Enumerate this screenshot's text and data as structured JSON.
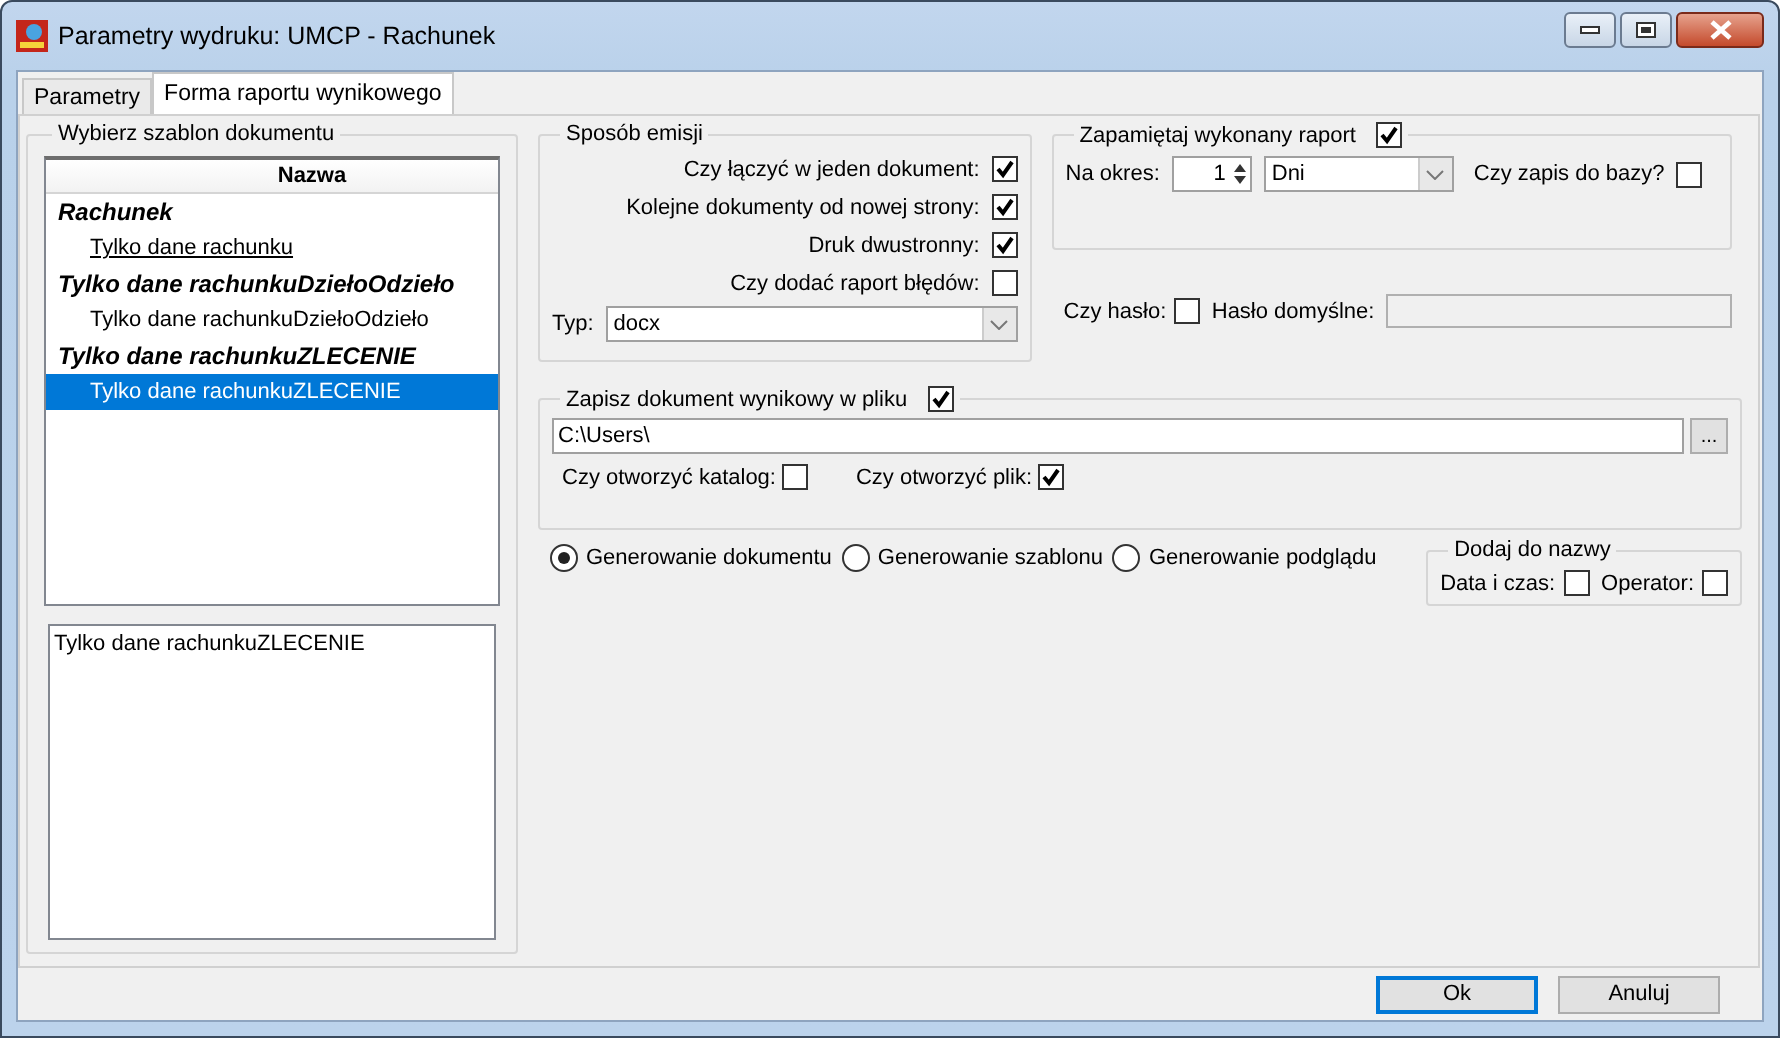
{
  "window": {
    "title": "Parametry wydruku: UMCP - Rachunek"
  },
  "tabs": [
    {
      "label": "Parametry",
      "selected": false
    },
    {
      "label": "Forma raportu wynikowego",
      "selected": true
    }
  ],
  "template_panel": {
    "title": "Wybierz szablon dokumentu",
    "column": "Nazwa",
    "groups": [
      {
        "label": "Rachunek",
        "children": [
          {
            "label": "Tylko dane rachunku",
            "selected": false,
            "hovered": true
          }
        ]
      },
      {
        "label": "Tylko dane rachunkuDziełoOdzieło",
        "children": [
          {
            "label": "Tylko dane rachunkuDziełoOdzieło",
            "selected": false,
            "hovered": false
          }
        ]
      },
      {
        "label": "Tylko dane rachunkuZLECENIE",
        "children": [
          {
            "label": "Tylko dane rachunkuZLECENIE",
            "selected": true,
            "hovered": false
          }
        ]
      }
    ],
    "description": "Tylko dane rachunkuZLECENIE"
  },
  "emission": {
    "title": "Sposób emisji",
    "options": [
      {
        "label": "Czy łączyć w jeden dokument:",
        "checked": true
      },
      {
        "label": "Kolejne dokumenty od nowej strony:",
        "checked": true
      },
      {
        "label": "Druk dwustronny:",
        "checked": true
      },
      {
        "label": "Czy dodać raport błędów:",
        "checked": false
      }
    ],
    "type_label": "Typ:",
    "type_value": "docx"
  },
  "remember": {
    "title": "Zapamiętaj wykonany raport",
    "checked": true,
    "period_label": "Na okres:",
    "period_value": "1",
    "unit_value": "Dni",
    "db_label": "Czy zapis do bazy?",
    "db_checked": false
  },
  "password": {
    "label": "Czy hasło:",
    "checked": false,
    "default_label": "Hasło domyślne:",
    "disabled": true
  },
  "save_file": {
    "title": "Zapisz dokument wynikowy w pliku",
    "checked": true,
    "path": "C:\\Users\\",
    "browse": "...",
    "open_dir_label": "Czy otworzyć katalog:",
    "open_dir": false,
    "open_file_label": "Czy otworzyć plik:",
    "open_file": true
  },
  "generation": [
    {
      "label": "Generowanie dokumentu",
      "selected": true
    },
    {
      "label": "Generowanie szablonu",
      "selected": false
    },
    {
      "label": "Generowanie podglądu",
      "selected": false
    }
  ],
  "add_to_name": {
    "title": "Dodaj do nazwy",
    "options": [
      {
        "label": "Data i czas:",
        "checked": false
      },
      {
        "label": "Operator:",
        "checked": false
      }
    ]
  },
  "buttons": [
    {
      "label": "Ok",
      "default": true
    },
    {
      "label": "Anuluj",
      "default": false
    }
  ]
}
